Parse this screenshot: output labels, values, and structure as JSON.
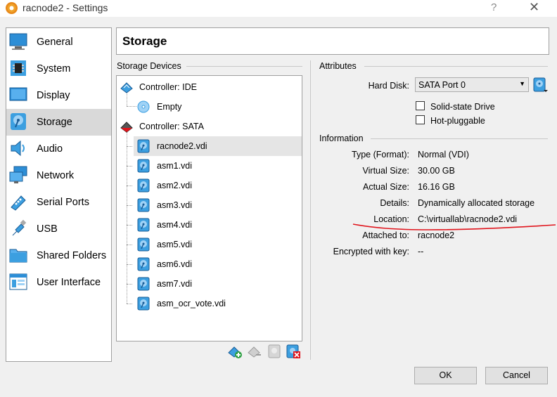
{
  "window": {
    "title": "racnode2 - Settings",
    "help": "?",
    "close": "✕"
  },
  "nav": {
    "items": [
      {
        "label": "General"
      },
      {
        "label": "System"
      },
      {
        "label": "Display"
      },
      {
        "label": "Storage"
      },
      {
        "label": "Audio"
      },
      {
        "label": "Network"
      },
      {
        "label": "Serial Ports"
      },
      {
        "label": "USB"
      },
      {
        "label": "Shared Folders"
      },
      {
        "label": "User Interface"
      }
    ],
    "selected": "Storage"
  },
  "page": {
    "title": "Storage"
  },
  "storage_devices": {
    "section_title": "Storage Devices",
    "controllers": [
      {
        "label": "Controller: IDE",
        "children": [
          "Empty"
        ]
      },
      {
        "label": "Controller: SATA",
        "children": [
          "racnode2.vdi",
          "asm1.vdi",
          "asm2.vdi",
          "asm3.vdi",
          "asm4.vdi",
          "asm5.vdi",
          "asm6.vdi",
          "asm7.vdi",
          "asm_ocr_vote.vdi"
        ]
      }
    ],
    "selected": "racnode2.vdi"
  },
  "attributes": {
    "section_title": "Attributes",
    "hard_disk_label": "Hard Disk:",
    "hard_disk_value": "SATA Port 0",
    "ssd_label": "Solid-state Drive",
    "hotplug_label": "Hot-pluggable",
    "ssd_checked": false,
    "hotplug_checked": false
  },
  "information": {
    "section_title": "Information",
    "type_label": "Type (Format):",
    "type_value": "Normal (VDI)",
    "vsize_label": "Virtual Size:",
    "vsize_value": "30.00 GB",
    "asize_label": "Actual Size:",
    "asize_value": "16.16 GB",
    "details_label": "Details:",
    "details_value": "Dynamically allocated storage",
    "location_label": "Location:",
    "location_value": "C:\\virtuallab\\racnode2.vdi",
    "attached_label": "Attached to:",
    "attached_value": "racnode2",
    "encrypted_label": "Encrypted with key:",
    "encrypted_value": "--"
  },
  "buttons": {
    "ok": "OK",
    "cancel": "Cancel"
  },
  "colors": {
    "accent_blue": "#1e7fc9",
    "annotation_red": "#e0141c"
  }
}
